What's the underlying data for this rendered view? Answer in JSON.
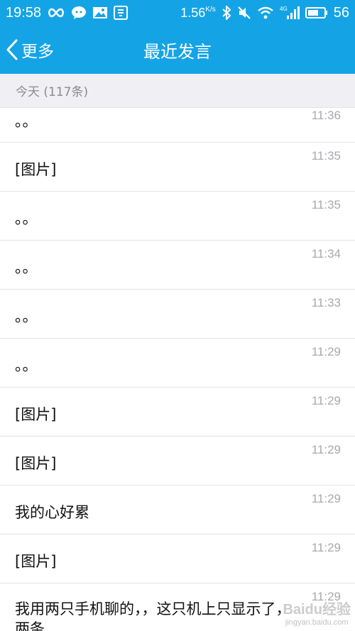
{
  "status_bar": {
    "time": "19:58",
    "speed": "1.56",
    "speed_unit": "K/s",
    "battery_level": "56",
    "network_badge": "4G"
  },
  "header": {
    "back_label": "更多",
    "title": "最近发言"
  },
  "section": {
    "label": "今天 (117条)"
  },
  "messages": [
    {
      "text": "。。",
      "time": "11:36"
    },
    {
      "text": "[图片]",
      "time": "11:35"
    },
    {
      "text": "。。",
      "time": "11:35"
    },
    {
      "text": "。。",
      "time": "11:34"
    },
    {
      "text": "。。",
      "time": "11:33"
    },
    {
      "text": "。。",
      "time": "11:29"
    },
    {
      "text": "[图片]",
      "time": "11:29"
    },
    {
      "text": "[图片]",
      "time": "11:29"
    },
    {
      "text": "我的心好累",
      "time": "11:29"
    },
    {
      "text": "[图片]",
      "time": "11:29"
    },
    {
      "text": "我用两只手机聊的，，这只机上只显示了，两条",
      "time": "11:29"
    }
  ],
  "watermark": {
    "main": "Baidu经验",
    "sub": "jingyan.baidu.com"
  },
  "colors": {
    "brand": "#14a4e6",
    "section_bg": "#efeff4",
    "time_text": "#a9a9ae"
  }
}
